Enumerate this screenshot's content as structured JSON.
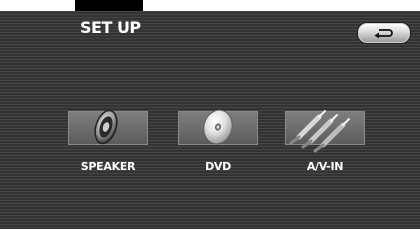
{
  "header": {
    "title": "SET UP",
    "back_icon": "return-arrow-icon"
  },
  "menu": {
    "items": [
      {
        "label": "SPEAKER",
        "icon": "speaker-icon"
      },
      {
        "label": "DVD",
        "icon": "disc-icon"
      },
      {
        "label": "A/V-IN",
        "icon": "av-cable-icon"
      }
    ]
  },
  "colors": {
    "background": "#3a3a3a",
    "text": "#ffffff",
    "tile": "#6e6e6e",
    "button": "#dcdcdc"
  }
}
